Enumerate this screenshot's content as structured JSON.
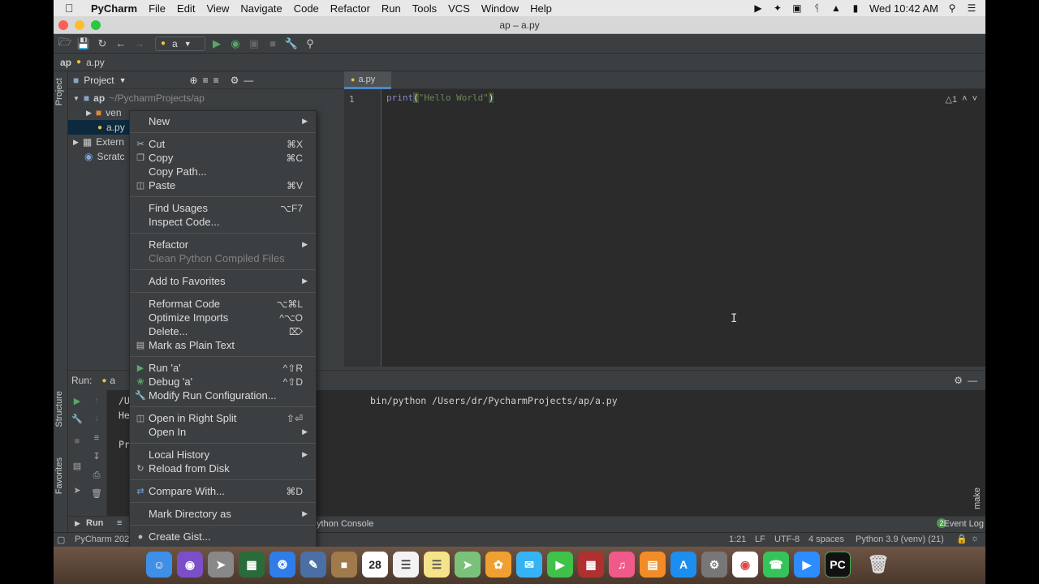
{
  "menubar": {
    "app_name": "PyCharm",
    "items": [
      "File",
      "Edit",
      "View",
      "Navigate",
      "Code",
      "Refactor",
      "Run",
      "Tools",
      "VCS",
      "Window",
      "Help"
    ],
    "clock": "Wed 10:42 AM"
  },
  "window": {
    "title": "ap – a.py"
  },
  "toolbar": {
    "run_config": "a"
  },
  "navbar": {
    "project": "ap",
    "file": "a.py"
  },
  "project_panel": {
    "title": "Project",
    "side_label": "Project",
    "root_name": "ap",
    "root_path": "~/PycharmProjects/ap",
    "venv_label": "ven",
    "file_label": "a.py",
    "external_label": "Extern",
    "scratch_label": "Scratc"
  },
  "editor": {
    "tab_label": "a.py",
    "line_number": "1",
    "code_func": "print",
    "code_open": "(",
    "code_string": "\"Hello World\"",
    "code_close": ")",
    "warning_count": "1"
  },
  "run_panel": {
    "title": "Run:",
    "config_tab": "a",
    "output_line1_start": "/U",
    "output_line1_end": "bin/python /Users/dr/PycharmProjects/ap/a.py",
    "output_line2": "He",
    "output_line3": "Pr"
  },
  "tool_windows": {
    "run_tab": "Run",
    "python_console_tab": "ython Console",
    "event_log": "Event Log",
    "event_log_count": "2",
    "structure_label": "Structure",
    "favorites_label": "Favorites",
    "make_label": "make"
  },
  "statusbar": {
    "left": "PyCharm 202",
    "position": "1:21",
    "line_sep": "LF",
    "encoding": "UTF-8",
    "indent": "4 spaces",
    "interpreter": "Python 3.9 (venv) (21)"
  },
  "context_menu": {
    "new": "New",
    "cut": "Cut",
    "cut_sc": "⌘X",
    "copy": "Copy",
    "copy_sc": "⌘C",
    "copy_path": "Copy Path...",
    "paste": "Paste",
    "paste_sc": "⌘V",
    "find_usages": "Find Usages",
    "find_usages_sc": "⌥F7",
    "inspect_code": "Inspect Code...",
    "refactor": "Refactor",
    "clean_compiled": "Clean Python Compiled Files",
    "add_favorites": "Add to Favorites",
    "reformat": "Reformat Code",
    "reformat_sc": "⌥⌘L",
    "optimize_imports": "Optimize Imports",
    "optimize_imports_sc": "^⌥O",
    "delete": "Delete...",
    "delete_sc": "⌦",
    "mark_plain": "Mark as Plain Text",
    "run": "Run 'a'",
    "run_sc": "^⇧R",
    "debug": "Debug 'a'",
    "debug_sc": "^⇧D",
    "modify_run": "Modify Run Configuration...",
    "open_right": "Open in Right Split",
    "open_right_sc": "⇧⏎",
    "open_in": "Open In",
    "local_history": "Local History",
    "reload": "Reload from Disk",
    "compare": "Compare With...",
    "compare_sc": "⌘D",
    "mark_dir": "Mark Directory as",
    "create_gist": "Create Gist..."
  },
  "dock": {
    "calendar_day": "28",
    "pycharm_label": "PC"
  }
}
